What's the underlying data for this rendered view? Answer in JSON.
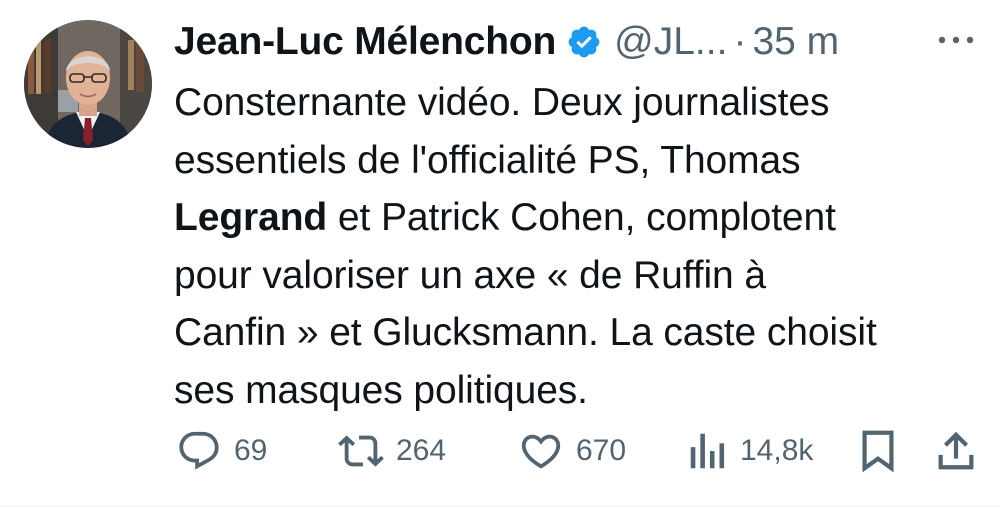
{
  "author": {
    "name": "Jean-Luc Mélenchon",
    "handle": "@JL...",
    "separator": "·",
    "time": "35 m",
    "verified": true,
    "verified_color": "#1d9bf0"
  },
  "tweet": {
    "lines": [
      [
        "Consternante vidéo. Deux journalistes"
      ],
      [
        "essentiels de l'officialité PS, Thomas"
      ],
      [
        "Legrand",
        " et Patrick Cohen, complotent"
      ],
      [
        "pour valoriser un axe « de Ruffin à"
      ],
      [
        "Canfin » et Glucksmann. La caste choisit"
      ],
      [
        "ses masques politiques."
      ]
    ]
  },
  "actions": {
    "reply": {
      "icon": "reply-icon",
      "count": "69"
    },
    "retweet": {
      "icon": "retweet-icon",
      "count": "264"
    },
    "like": {
      "icon": "heart-icon",
      "count": "670"
    },
    "views": {
      "icon": "views-icon",
      "count": "14,8k"
    },
    "bookmark": {
      "icon": "bookmark-icon"
    },
    "share": {
      "icon": "share-icon"
    }
  },
  "colors": {
    "text": "#0f1419",
    "secondary": "#536471",
    "accent": "#1d9bf0"
  }
}
